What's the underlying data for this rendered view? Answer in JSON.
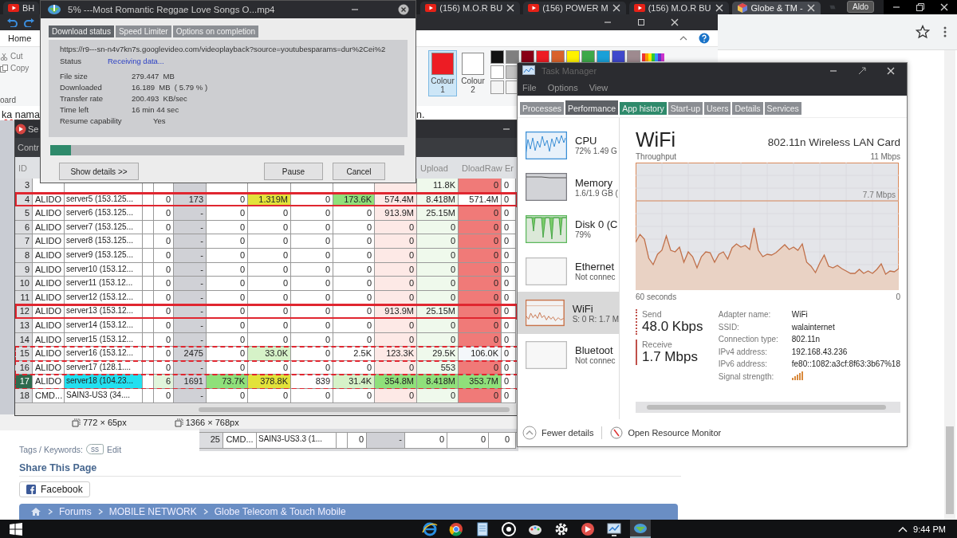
{
  "browser": {
    "tabs": [
      {
        "title": "BH",
        "kind": "video",
        "selected": false
      },
      {
        "title": "(156) M.O.R BU",
        "kind": "video",
        "selected": false
      },
      {
        "title": "(156) POWER M",
        "kind": "video",
        "selected": false
      },
      {
        "title": "(156) M.O.R BU",
        "kind": "video",
        "selected": false
      },
      {
        "title": "Globe & TM -",
        "kind": "site",
        "selected": true
      }
    ],
    "profile": "Aldo",
    "page": {
      "tags_label": "Tags / Keywords:",
      "tag": "ss",
      "edit_link": "Edit",
      "share_heading": "Share This Page",
      "share_button": "Facebook",
      "breadcrumb": [
        "Forums",
        "MOBILE NETWORK",
        "Globe Telecom & Touch Mobile"
      ]
    }
  },
  "paint": {
    "ribbon_tab": "Home",
    "clipboard_items": [
      "Cut",
      "Copy"
    ],
    "group_label": "oard",
    "colour_slots": [
      {
        "label": "Colour 1",
        "color": "#ed1c24",
        "selected": true
      },
      {
        "label": "Colour 2",
        "color": "#ffffff",
        "selected": false
      }
    ],
    "palette": [
      [
        {
          "color": "#111111"
        },
        {
          "color": "#7f7f7f"
        },
        {
          "color": "#880015"
        },
        {
          "color": "#ed1c24"
        },
        {
          "color": "#d9622b"
        },
        {
          "color": "#fff200"
        },
        {
          "color": "#3ea84a"
        },
        {
          "color": "#1aa0d8"
        },
        {
          "color": "#3f48cc"
        },
        {
          "color": "#9e8a8f"
        }
      ],
      [
        {
          "color": "#ffffff"
        },
        {
          "color": "#c3c3c3"
        }
      ],
      [
        {
          "color": "#f4f4f4"
        },
        {
          "color": "#f4f4f4"
        }
      ]
    ],
    "document_lines": [
      "ka nama",
      "n."
    ],
    "status": [
      "772 × 65px",
      "1366 × 768px"
    ]
  },
  "server_monitor": {
    "title": "Se",
    "toolbar_label": "Contr",
    "columns": [
      "ID",
      null,
      null,
      null,
      null,
      null,
      null,
      null,
      null,
      null,
      null,
      "Upload",
      "DloadRaw",
      "Er"
    ],
    "rows": [
      {
        "selected": false,
        "boxed": false,
        "dashed": false,
        "cells": [
          "3",
          null,
          null,
          null,
          null,
          null,
          null,
          null,
          null,
          null,
          null,
          "11.8K",
          "0",
          "0"
        ]
      },
      {
        "selected": false,
        "boxed": true,
        "dashed": false,
        "cells": [
          "4",
          "ALIDO",
          "server5 (153.125...",
          null,
          "0",
          "173",
          "0",
          {
            "text": "1.319M",
            "color": "#e2e23a"
          },
          "0",
          {
            "text": "173.6K",
            "color": "#8fe07a"
          },
          "574.4M",
          "8.418M",
          {
            "text": "571.4M",
            "color": "#ffffff"
          },
          "0"
        ]
      },
      {
        "selected": false,
        "boxed": false,
        "dashed": false,
        "cells": [
          "5",
          "ALIDO",
          "server6 (153.125...",
          null,
          "0",
          "-",
          "0",
          "0",
          "0",
          "0",
          "913.9M",
          "25.15M",
          "0",
          "0"
        ]
      },
      {
        "selected": false,
        "boxed": false,
        "dashed": false,
        "cells": [
          "6",
          "ALIDO",
          "server7 (153.125...",
          null,
          "0",
          "-",
          "0",
          "0",
          "0",
          "0",
          "0",
          "0",
          "0",
          "0"
        ]
      },
      {
        "selected": false,
        "boxed": false,
        "dashed": false,
        "cells": [
          "7",
          "ALIDO",
          "server8 (153.125...",
          null,
          "0",
          "-",
          "0",
          "0",
          "0",
          "0",
          "0",
          "0",
          "0",
          "0"
        ]
      },
      {
        "selected": false,
        "boxed": false,
        "dashed": false,
        "cells": [
          "8",
          "ALIDO",
          "server9 (153.125...",
          null,
          "0",
          "-",
          "0",
          "0",
          "0",
          "0",
          "0",
          "0",
          "0",
          "0"
        ]
      },
      {
        "selected": false,
        "boxed": false,
        "dashed": false,
        "cells": [
          "9",
          "ALIDO",
          "server10 (153.12...",
          null,
          "0",
          "-",
          "0",
          "0",
          "0",
          "0",
          "0",
          "0",
          "0",
          "0"
        ]
      },
      {
        "selected": false,
        "boxed": false,
        "dashed": false,
        "cells": [
          "10",
          "ALIDO",
          "server11 (153.12...",
          null,
          "0",
          "-",
          "0",
          "0",
          "0",
          "0",
          "0",
          "0",
          "0",
          "0"
        ]
      },
      {
        "selected": false,
        "boxed": false,
        "dashed": false,
        "cells": [
          "11",
          "ALIDO",
          "server12 (153.12...",
          null,
          "0",
          "-",
          "0",
          "0",
          "0",
          "0",
          "0",
          "0",
          "0",
          "0"
        ]
      },
      {
        "selected": false,
        "boxed": true,
        "dashed": false,
        "cells": [
          "12",
          "ALIDO",
          "server13 (153.12...",
          null,
          "0",
          "-",
          "0",
          "0",
          "0",
          "0",
          "913.9M",
          "25.15M",
          "0",
          "0"
        ]
      },
      {
        "selected": false,
        "boxed": false,
        "dashed": false,
        "cells": [
          "13",
          "ALIDO",
          "server14 (153.12...",
          null,
          "0",
          "-",
          "0",
          "0",
          "0",
          "0",
          "0",
          "0",
          "0",
          "0"
        ]
      },
      {
        "selected": false,
        "boxed": false,
        "dashed": false,
        "cells": [
          "14",
          "ALIDO",
          "server15 (153.12...",
          null,
          "0",
          "-",
          "0",
          "0",
          "0",
          "0",
          "0",
          "0",
          "0",
          "0"
        ]
      },
      {
        "selected": false,
        "boxed": true,
        "dashed": true,
        "cells": [
          "15",
          "ALIDO",
          "server16 (153.12...",
          null,
          "0",
          "2475",
          "0",
          {
            "text": "33.0K",
            "color": "#d6f2c8"
          },
          "0",
          "2.5K",
          "123.3K",
          "29.5K",
          {
            "text": "106.0K",
            "color": "#f4f7fa"
          },
          "0"
        ]
      },
      {
        "selected": false,
        "boxed": true,
        "dashed": true,
        "cells": [
          "16",
          "ALIDO",
          "server17 (128.1....",
          null,
          "0",
          "-",
          "0",
          "0",
          "0",
          "0",
          "0",
          "553",
          "0",
          "0"
        ]
      },
      {
        "selected": true,
        "boxed": true,
        "dashed": true,
        "cells": [
          "17",
          "ALIDO",
          {
            "text": "server18 (104.23...",
            "color": "#22e0f0"
          },
          null,
          {
            "text": "6",
            "color": "#e2f5dc"
          },
          "1691",
          {
            "text": "73.7K",
            "color": "#8fe07a"
          },
          {
            "text": "378.8K",
            "color": "#e2e23a"
          },
          "839",
          {
            "text": "31.4K",
            "color": "#d6f2c8"
          },
          {
            "text": "354.8M",
            "color": "#8fe07a"
          },
          {
            "text": "8.418M",
            "color": "#8fe07a"
          },
          {
            "text": "353.7M",
            "color": "#8fe07a"
          },
          "0"
        ]
      },
      {
        "selected": false,
        "boxed": false,
        "dashed": false,
        "cells": [
          "18",
          "CMD...",
          "SAIN3-US3 (34....",
          null,
          "0",
          "-",
          "0",
          "0",
          "0",
          "0",
          "0",
          "0",
          "0",
          "0"
        ]
      }
    ]
  },
  "server_row_window": {
    "cells": [
      "25",
      "CMD...",
      "SAIN3-US3.3 (1...",
      null,
      "0",
      "-",
      "0",
      "0",
      "0"
    ]
  },
  "download": {
    "title": "5% ---Most Romantic Reggae Love Songs O...mp4",
    "tabs": [
      {
        "label": "Download status",
        "selected": true
      },
      {
        "label": "Speed Limiter",
        "selected": false
      },
      {
        "label": "Options on completion",
        "selected": false
      }
    ],
    "url": "https://r9---sn-n4v7kn7s.googlevideo.com/videoplayback?source=youtubesparams=dur%2Cei%2",
    "status_label": "Status",
    "status_value": "Receiving data...",
    "fields": [
      {
        "label": "File size",
        "value": "279.447  MB"
      },
      {
        "label": "Downloaded",
        "value": "16.189  MB  ( 5.79 % )"
      },
      {
        "label": "Transfer rate",
        "value": "200.493  KB/sec"
      },
      {
        "label": "Time left",
        "value": "16 min 44 sec"
      },
      {
        "label": "Resume capability",
        "value": "Yes"
      }
    ],
    "level": 0.0579,
    "buttons": [
      "Show details >>",
      "Pause",
      "Cancel"
    ]
  },
  "task_manager": {
    "title": "Task Manager",
    "menu": [
      "File",
      "Options",
      "View"
    ],
    "tabs": [
      {
        "label": "Processes",
        "selected": false,
        "hovered": false
      },
      {
        "label": "Performance",
        "selected": true,
        "hovered": false
      },
      {
        "label": "App history",
        "selected": false,
        "hovered": true
      },
      {
        "label": "Start-up",
        "selected": false,
        "hovered": false
      },
      {
        "label": "Users",
        "selected": false,
        "hovered": false
      },
      {
        "label": "Details",
        "selected": false,
        "hovered": false
      },
      {
        "label": "Services",
        "selected": false,
        "hovered": false
      }
    ],
    "resources": [
      {
        "kind": "cpu",
        "name": "CPU",
        "detail": "72% 1.49 G",
        "selected": false
      },
      {
        "kind": "memory",
        "name": "Memory",
        "detail": "1.6/1.9 GB (",
        "selected": false
      },
      {
        "kind": "disk",
        "name": "Disk 0 (C",
        "detail": "79%",
        "selected": false
      },
      {
        "kind": "ethernet",
        "name": "Ethernet",
        "detail": "Not connec",
        "selected": false
      },
      {
        "kind": "wifi",
        "name": "WiFi",
        "detail": "S: 0 R: 1.7 M",
        "selected": true
      },
      {
        "kind": "bluetooth",
        "name": "Bluetoot",
        "detail": "Not connec",
        "selected": false
      }
    ],
    "detail": {
      "title": "WiFi",
      "adapter": "802.11n Wireless LAN Card",
      "graph_label": "Throughput",
      "graph_max": "11 Mbps",
      "graph_marker": "7.7 Mbps",
      "graph_span": "60 seconds",
      "graph_min": "0",
      "send_label": "Send",
      "send_value": "48.0 Kbps",
      "receive_label": "Receive",
      "receive_value": "1.7 Mbps",
      "properties": [
        {
          "kind": "text",
          "label": "Adapter name:",
          "value": "WiFi"
        },
        {
          "kind": "text",
          "label": "SSID:",
          "value": "walainternet"
        },
        {
          "kind": "text",
          "label": "Connection type:",
          "value": "802.11n"
        },
        {
          "kind": "text",
          "label": "IPv4 address:",
          "value": "192.168.43.236"
        },
        {
          "kind": "text",
          "label": "IPv6 address:",
          "value": "fe80::1082:a3cf:8f63:3b67%18"
        },
        {
          "kind": "signal",
          "label": "Signal strength:"
        }
      ]
    },
    "footer": {
      "fewer": "Fewer details",
      "monitor": "Open Resource Monitor"
    }
  },
  "taskbar": {
    "time": "9:44 PM"
  }
}
